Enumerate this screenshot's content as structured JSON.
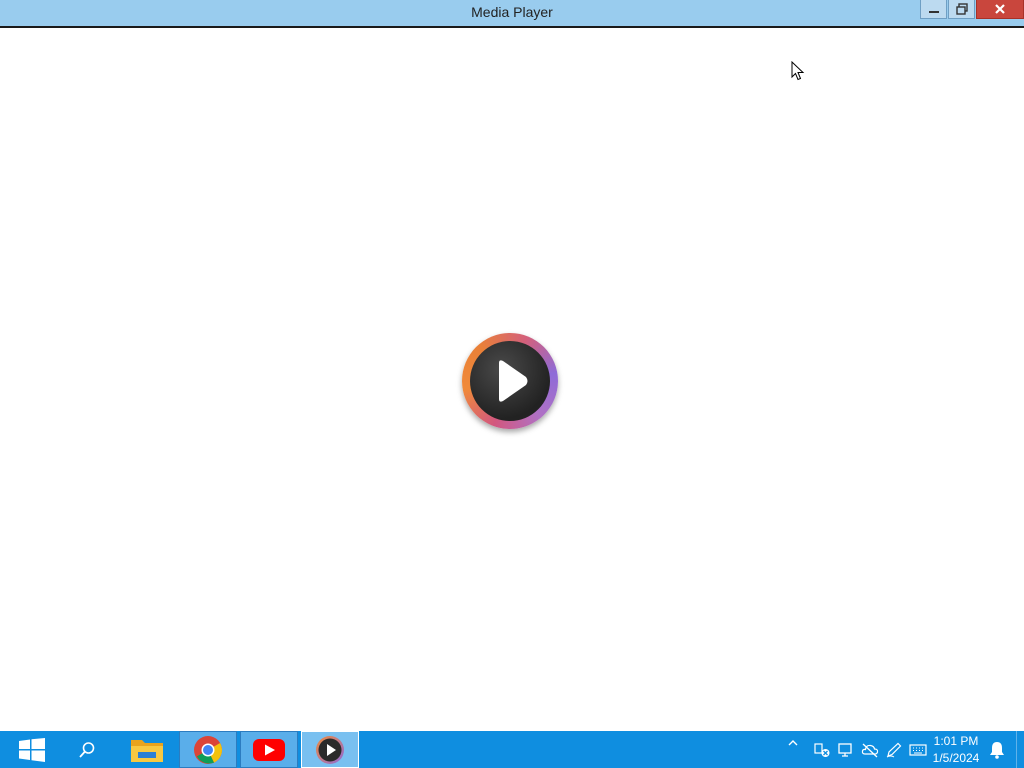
{
  "window": {
    "title": "Media Player",
    "controls": {
      "minimize": "minimize-icon",
      "restore": "restore-icon",
      "close": "close-icon"
    }
  },
  "content": {
    "center_icon": "play-icon"
  },
  "taskbar": {
    "start": "windows-logo-icon",
    "search": "search-icon",
    "apps": [
      {
        "name": "File Explorer",
        "icon": "folder-icon"
      },
      {
        "name": "Google Chrome",
        "icon": "chrome-icon"
      },
      {
        "name": "YouTube",
        "icon": "youtube-icon"
      },
      {
        "name": "Media Player",
        "icon": "media-player-icon",
        "active": true
      }
    ],
    "tray": {
      "icons": [
        "chevron-up-icon",
        "network-error-icon",
        "display-icon",
        "cloud-off-icon",
        "pen-icon",
        "keyboard-icon",
        "notification-icon"
      ],
      "time": "1:01 PM",
      "date": "1/5/2024"
    }
  },
  "colors": {
    "titlebar": "#99ccee",
    "taskbar": "#0f8ee0",
    "close": "#c9463d"
  }
}
